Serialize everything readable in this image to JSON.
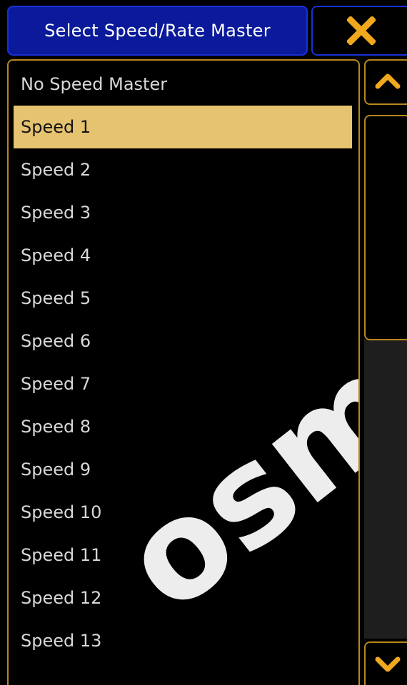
{
  "dialog": {
    "title": "Select Speed/Rate Master",
    "close_icon": "close-x-icon",
    "accent_color": "#f0a81e",
    "title_bg_color": "#0a1a9a",
    "border_color": "#b8861e",
    "selected_bg_color": "#e6c370"
  },
  "list": {
    "items": [
      {
        "label": "No Speed Master"
      },
      {
        "label": "Speed 1",
        "selected": true
      },
      {
        "label": "Speed 2"
      },
      {
        "label": "Speed 3"
      },
      {
        "label": "Speed 4"
      },
      {
        "label": "Speed 5"
      },
      {
        "label": "Speed 6"
      },
      {
        "label": "Speed 7"
      },
      {
        "label": "Speed 8"
      },
      {
        "label": "Speed 9"
      },
      {
        "label": "Speed 10"
      },
      {
        "label": "Speed 11"
      },
      {
        "label": "Speed 12"
      },
      {
        "label": "Speed 13"
      }
    ]
  },
  "scrollbar": {
    "up_icon": "chevron-up-icon",
    "down_icon": "chevron-down-icon"
  }
}
